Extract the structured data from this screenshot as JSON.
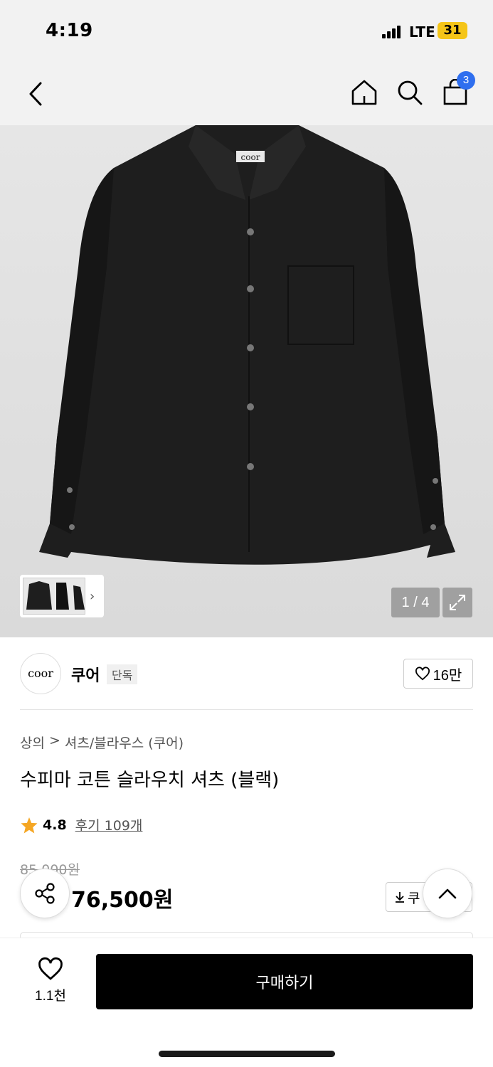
{
  "status_bar": {
    "time": "4:19",
    "network": "LTE",
    "battery": "31"
  },
  "nav": {
    "cart_count": "3"
  },
  "gallery": {
    "page_indicator": "1 / 4",
    "current_page": 1,
    "total_pages": 4
  },
  "brand": {
    "logo_text": "coor",
    "name": "쿠어",
    "badge": "단독",
    "like_count": "16만"
  },
  "breadcrumb": {
    "category": "상의",
    "separator": ">",
    "subcategory": "셔츠/블라우스 (쿠어)"
  },
  "product": {
    "title": "수피마 코튼 슬라우치 셔츠 (블랙)",
    "rating": "4.8",
    "review_label": "후기 109개",
    "original_price": "85,000원",
    "sale_price": "76,500원",
    "coupon_label": "쿠"
  },
  "bottom_bar": {
    "wish_count": "1.1천",
    "buy_label": "구매하기"
  },
  "colors": {
    "accent_blue": "#2f6fef",
    "star": "#f5a623",
    "battery": "#f5c518"
  }
}
